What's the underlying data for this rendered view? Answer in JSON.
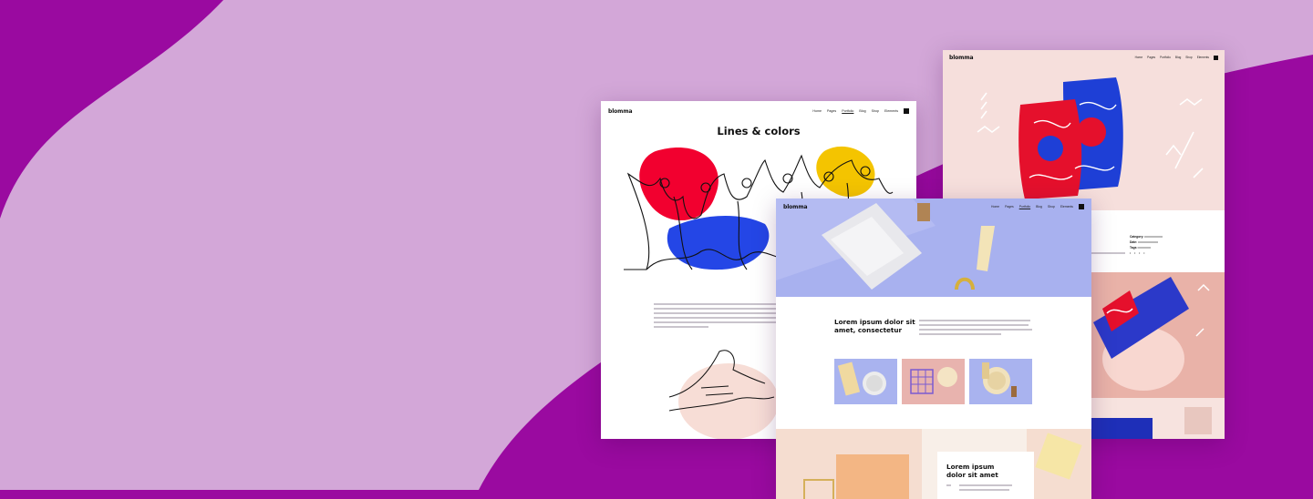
{
  "colors": {
    "bg_dark": "#9a0aa0",
    "bg_light": "#d3a7d8"
  },
  "template_a": {
    "logo": "blomma",
    "nav": [
      "Home",
      "Pages",
      "Portfolio",
      "Blog",
      "Shop",
      "Elements"
    ],
    "active_nav": "Portfolio",
    "title": "Lines & colors"
  },
  "template_b": {
    "logo": "blomma",
    "nav": [
      "Home",
      "Pages",
      "Portfolio",
      "Blog",
      "Shop",
      "Elements"
    ],
    "meta": {
      "category_label": "Category:",
      "date_label": "Date:",
      "tags_label": "Tags:"
    }
  },
  "template_c": {
    "logo": "blomma",
    "nav": [
      "Home",
      "Pages",
      "Portfolio",
      "Blog",
      "Shop",
      "Elements"
    ],
    "heading": "Lorem ipsum dolor sit amet, consectetur",
    "card_heading": "Lorem ipsum dolor sit amet"
  }
}
